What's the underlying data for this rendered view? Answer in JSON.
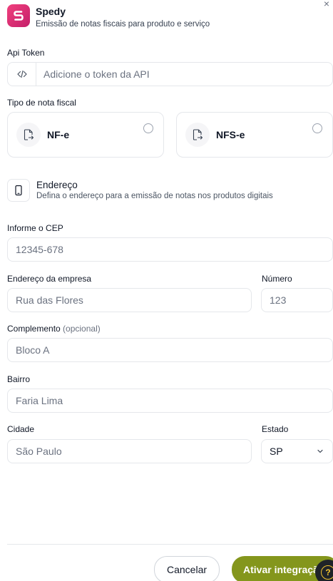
{
  "header": {
    "app_name": "Spedy",
    "subtitle": "Emissão de notas fiscais para produto e serviço",
    "close_label": "×"
  },
  "api_token": {
    "label": "Api Token",
    "placeholder": "Adicione o token da API",
    "prefix_icon": "code-icon"
  },
  "invoice_type": {
    "label": "Tipo de nota fiscal",
    "options": [
      {
        "label": "NF-e",
        "selected": false
      },
      {
        "label": "NFS-e",
        "selected": false
      }
    ]
  },
  "address_section": {
    "title": "Endereço",
    "description": "Defina o endereço para a emissão de notas nos produtos digitais"
  },
  "fields": {
    "cep": {
      "label": "Informe o CEP",
      "placeholder": "12345-678"
    },
    "company_address": {
      "label": "Endereço da empresa",
      "placeholder": "Rua das Flores"
    },
    "number": {
      "label": "Número",
      "placeholder": "123"
    },
    "complement": {
      "label": "Complemento",
      "optional_label": "(opcional)",
      "placeholder": "Bloco A"
    },
    "neighborhood": {
      "label": "Bairro",
      "placeholder": "Faria Lima"
    },
    "city": {
      "label": "Cidade",
      "placeholder": "São Paulo"
    },
    "state": {
      "label": "Estado",
      "value": "SP"
    }
  },
  "footer": {
    "cancel_label": "Cancelar",
    "submit_label": "Ativar integração",
    "help_label": "?"
  },
  "colors": {
    "brand": "#e8367a",
    "primary_button": "#84961c",
    "help_fab": "#1f2328",
    "help_accent": "#f4c430"
  }
}
